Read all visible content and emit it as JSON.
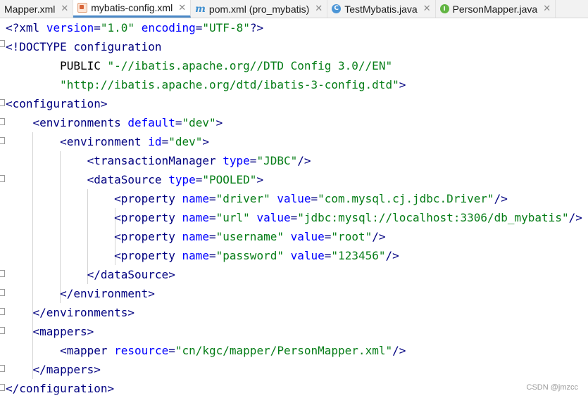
{
  "tabs": [
    {
      "label": "Mapper.xml",
      "icon": "xml-file-icon",
      "active": false
    },
    {
      "label": "mybatis-config.xml",
      "icon": "xml-file-icon",
      "active": true
    },
    {
      "label": "pom.xml (pro_mybatis)",
      "icon": "maven-icon",
      "active": false
    },
    {
      "label": "TestMybatis.java",
      "icon": "java-class-icon",
      "active": false
    },
    {
      "label": "PersonMapper.java",
      "icon": "java-interface-icon",
      "active": false
    }
  ],
  "code": [
    "<?xml version=\"1.0\" encoding=\"UTF-8\"?>",
    "<!DOCTYPE configuration",
    "        PUBLIC \"-//ibatis.apache.org//DTD Config 3.0//EN\"",
    "        \"http://ibatis.apache.org/dtd/ibatis-3-config.dtd\">",
    "<configuration>",
    "    <environments default=\"dev\">",
    "        <environment id=\"dev\">",
    "            <transactionManager type=\"JDBC\"/>",
    "            <dataSource type=\"POOLED\">",
    "                <property name=\"driver\" value=\"com.mysql.cj.jdbc.Driver\"/>",
    "                <property name=\"url\" value=\"jdbc:mysql://localhost:3306/db_mybatis\"/>",
    "                <property name=\"username\" value=\"root\"/>",
    "                <property name=\"password\" value=\"123456\"/>",
    "            </dataSource>",
    "        </environment>",
    "    </environments>",
    "    <mappers>",
    "        <mapper resource=\"cn/kgc/mapper/PersonMapper.xml\"/>",
    "    </mappers>",
    "</configuration>"
  ],
  "watermark": "CSDN @jmzcc",
  "colors": {
    "tag": "#000080",
    "attr_name": "#0000ff",
    "attr_value": "#067d17",
    "active_tab_underline": "#4a88c7"
  }
}
